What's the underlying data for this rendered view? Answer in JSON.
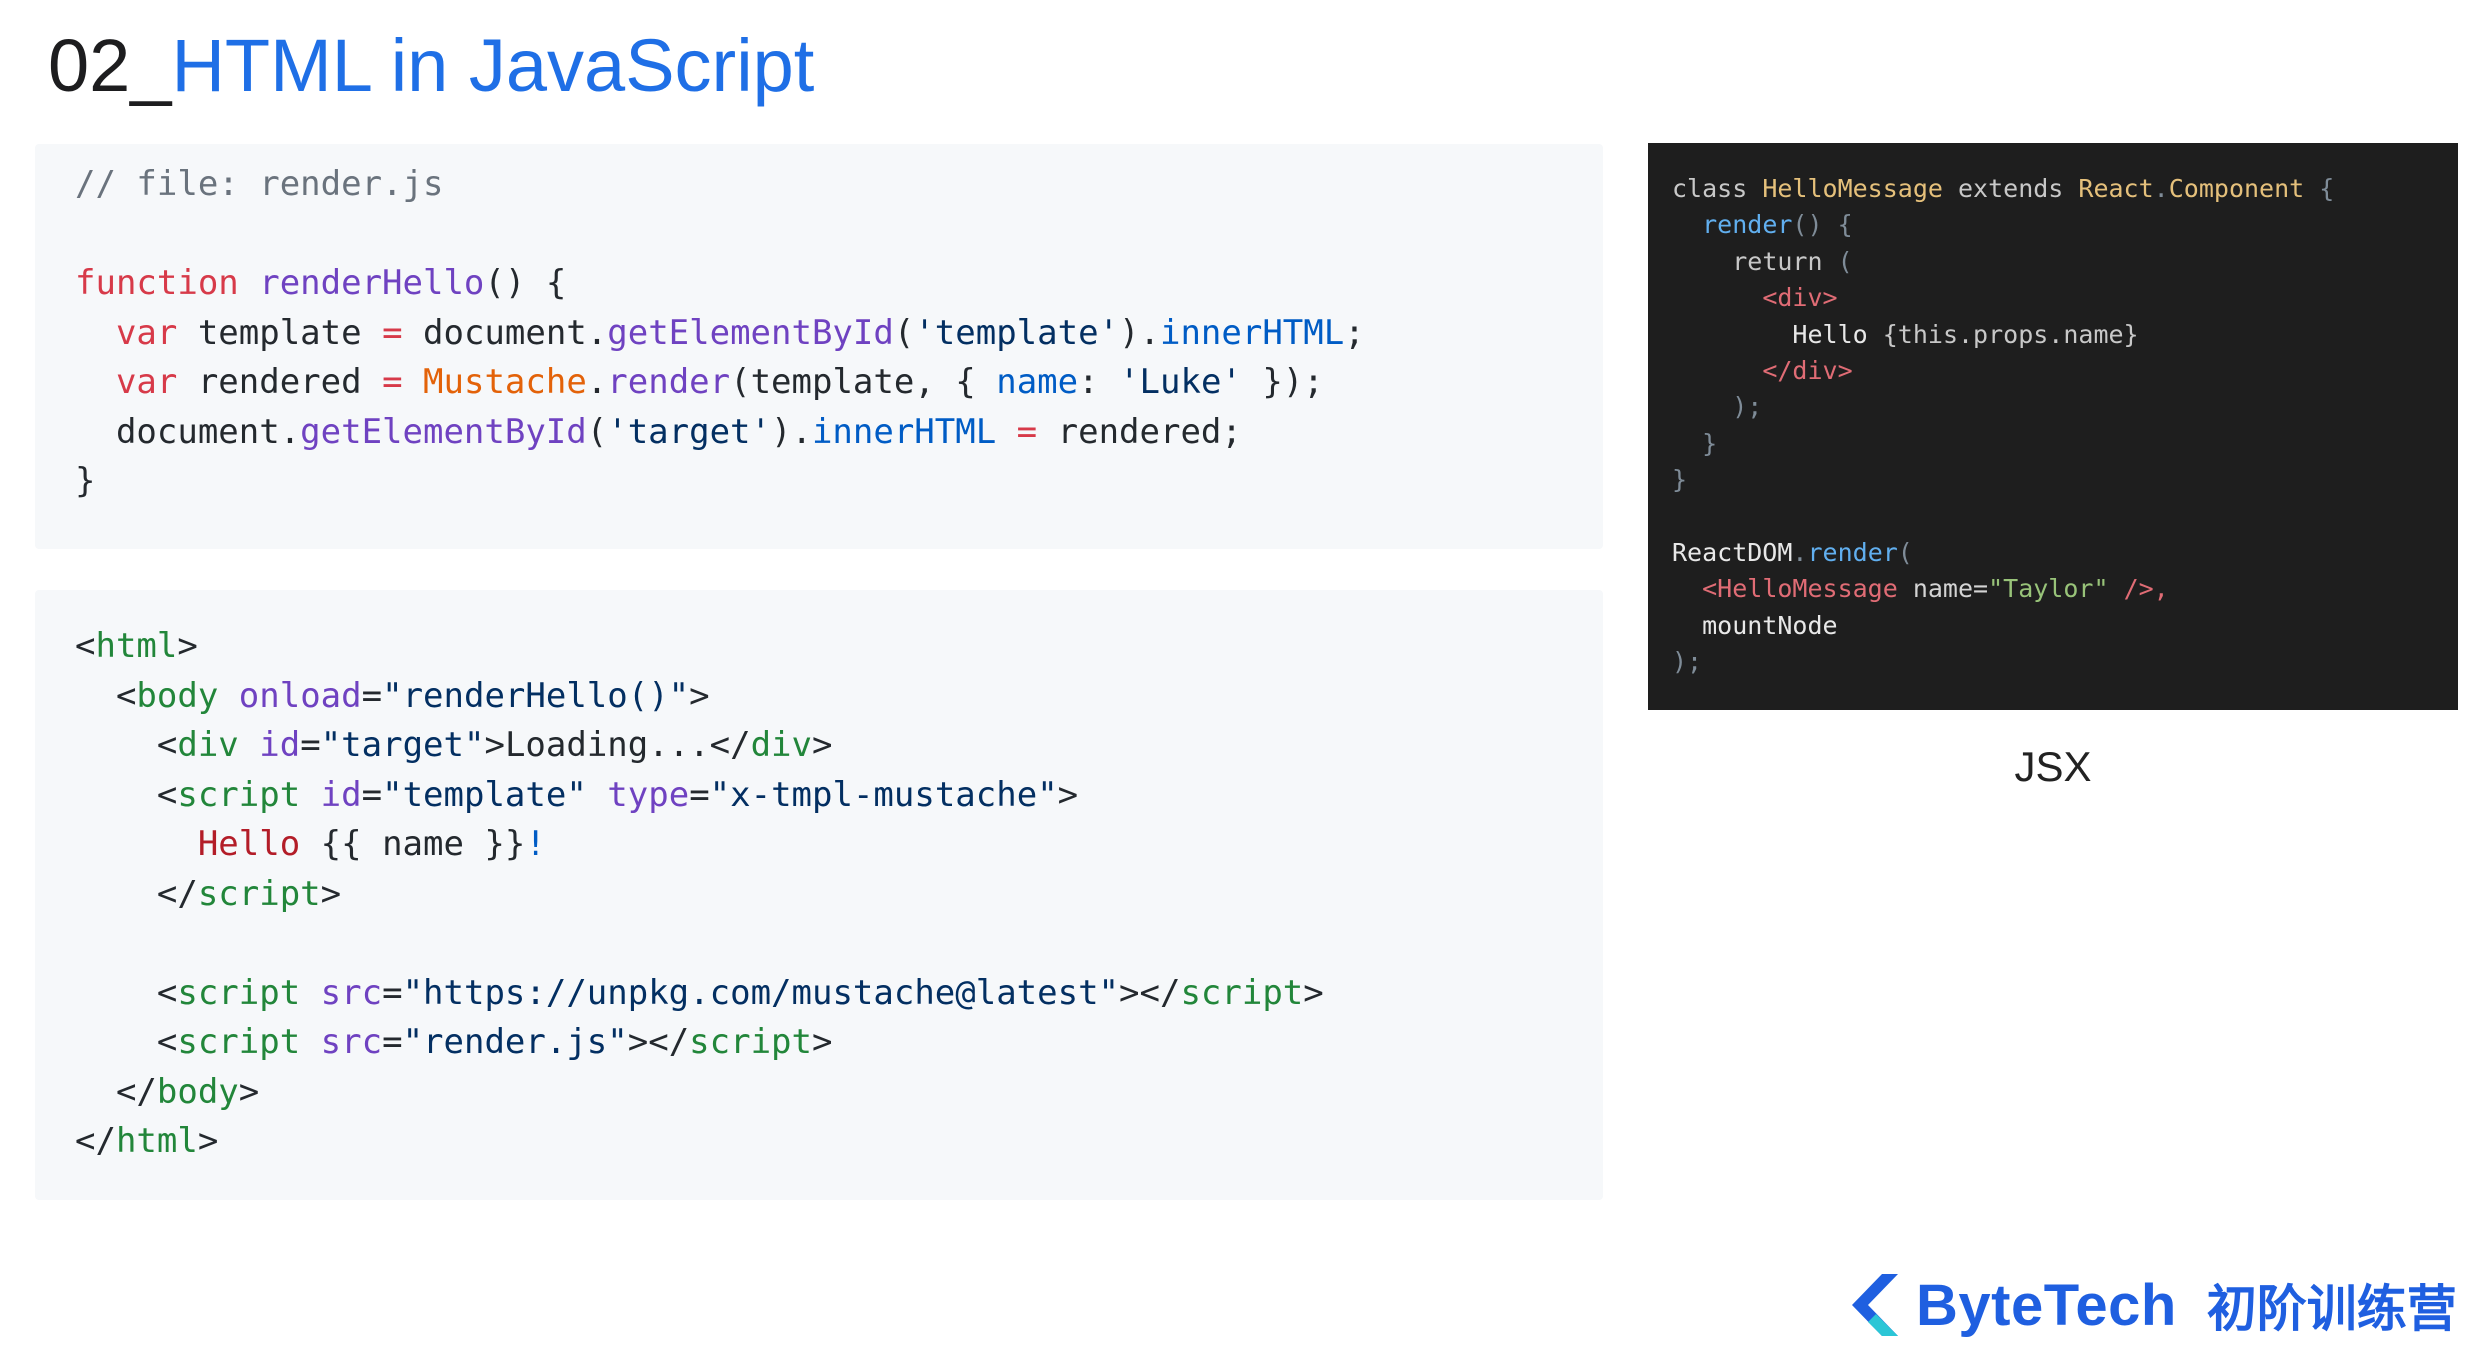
{
  "title": {
    "number": "02_",
    "text": "HTML in JavaScript"
  },
  "js_code": {
    "lines": [
      [
        {
          "t": "// file: render.js",
          "c": "cm"
        }
      ],
      [],
      [
        {
          "t": "function ",
          "c": "kw"
        },
        {
          "t": "renderHello",
          "c": "fn"
        },
        {
          "t": "() {",
          "c": ""
        }
      ],
      [
        {
          "t": "  var ",
          "c": "kw"
        },
        {
          "t": "template ",
          "c": ""
        },
        {
          "t": "=",
          "c": "kw"
        },
        {
          "t": " document.",
          "c": ""
        },
        {
          "t": "getElementById",
          "c": "fn"
        },
        {
          "t": "(",
          "c": ""
        },
        {
          "t": "'template'",
          "c": "st"
        },
        {
          "t": ").",
          "c": ""
        },
        {
          "t": "innerHTML",
          "c": "bl"
        },
        {
          "t": ";",
          "c": ""
        }
      ],
      [
        {
          "t": "  var ",
          "c": "kw"
        },
        {
          "t": "rendered ",
          "c": ""
        },
        {
          "t": "=",
          "c": "kw"
        },
        {
          "t": " ",
          "c": ""
        },
        {
          "t": "Mustache",
          "c": "cl"
        },
        {
          "t": ".",
          "c": ""
        },
        {
          "t": "render",
          "c": "fn"
        },
        {
          "t": "(template, { ",
          "c": ""
        },
        {
          "t": "name",
          "c": "bl"
        },
        {
          "t": ": ",
          "c": ""
        },
        {
          "t": "'Luke'",
          "c": "st"
        },
        {
          "t": " });",
          "c": ""
        }
      ],
      [
        {
          "t": "  document.",
          "c": ""
        },
        {
          "t": "getElementById",
          "c": "fn"
        },
        {
          "t": "(",
          "c": ""
        },
        {
          "t": "'target'",
          "c": "st"
        },
        {
          "t": ").",
          "c": ""
        },
        {
          "t": "innerHTML",
          "c": "bl"
        },
        {
          "t": " ",
          "c": ""
        },
        {
          "t": "=",
          "c": "kw"
        },
        {
          "t": " rendered;",
          "c": ""
        }
      ],
      [
        {
          "t": "}",
          "c": ""
        }
      ]
    ]
  },
  "html_code": {
    "lines": [
      [
        {
          "t": "<",
          "c": ""
        },
        {
          "t": "html",
          "c": "tg"
        },
        {
          "t": ">",
          "c": ""
        }
      ],
      [
        {
          "t": "  <",
          "c": ""
        },
        {
          "t": "body",
          "c": "tg"
        },
        {
          "t": " ",
          "c": ""
        },
        {
          "t": "onload",
          "c": "fn"
        },
        {
          "t": "=",
          "c": ""
        },
        {
          "t": "\"renderHello()\"",
          "c": "st"
        },
        {
          "t": ">",
          "c": ""
        }
      ],
      [
        {
          "t": "    <",
          "c": ""
        },
        {
          "t": "div",
          "c": "tg"
        },
        {
          "t": " ",
          "c": ""
        },
        {
          "t": "id",
          "c": "fn"
        },
        {
          "t": "=",
          "c": ""
        },
        {
          "t": "\"target\"",
          "c": "st"
        },
        {
          "t": ">Loading...</",
          "c": ""
        },
        {
          "t": "div",
          "c": "tg"
        },
        {
          "t": ">",
          "c": ""
        }
      ],
      [
        {
          "t": "    <",
          "c": ""
        },
        {
          "t": "script",
          "c": "tg"
        },
        {
          "t": " ",
          "c": ""
        },
        {
          "t": "id",
          "c": "fn"
        },
        {
          "t": "=",
          "c": ""
        },
        {
          "t": "\"template\"",
          "c": "st"
        },
        {
          "t": " ",
          "c": ""
        },
        {
          "t": "type",
          "c": "fn"
        },
        {
          "t": "=",
          "c": ""
        },
        {
          "t": "\"x-tmpl-mustache\"",
          "c": "st"
        },
        {
          "t": ">",
          "c": ""
        }
      ],
      [
        {
          "t": "      ",
          "c": ""
        },
        {
          "t": "Hello",
          "c": "brn"
        },
        {
          "t": " {{ name }}",
          "c": ""
        },
        {
          "t": "!",
          "c": "bl"
        }
      ],
      [
        {
          "t": "    </",
          "c": ""
        },
        {
          "t": "script",
          "c": "tg"
        },
        {
          "t": ">",
          "c": ""
        }
      ],
      [],
      [
        {
          "t": "    <",
          "c": ""
        },
        {
          "t": "script",
          "c": "tg"
        },
        {
          "t": " ",
          "c": ""
        },
        {
          "t": "src",
          "c": "fn"
        },
        {
          "t": "=",
          "c": ""
        },
        {
          "t": "\"https://unpkg.com/mustache@latest\"",
          "c": "st"
        },
        {
          "t": "></",
          "c": ""
        },
        {
          "t": "script",
          "c": "tg"
        },
        {
          "t": ">",
          "c": ""
        }
      ],
      [
        {
          "t": "    <",
          "c": ""
        },
        {
          "t": "script",
          "c": "tg"
        },
        {
          "t": " ",
          "c": ""
        },
        {
          "t": "src",
          "c": "fn"
        },
        {
          "t": "=",
          "c": ""
        },
        {
          "t": "\"render.js\"",
          "c": "st"
        },
        {
          "t": "></",
          "c": ""
        },
        {
          "t": "script",
          "c": "tg"
        },
        {
          "t": ">",
          "c": ""
        }
      ],
      [
        {
          "t": "  </",
          "c": ""
        },
        {
          "t": "body",
          "c": "tg"
        },
        {
          "t": ">",
          "c": ""
        }
      ],
      [
        {
          "t": "</",
          "c": ""
        },
        {
          "t": "html",
          "c": "tg"
        },
        {
          "t": ">",
          "c": ""
        }
      ]
    ]
  },
  "jsx_code": {
    "lines": [
      [
        {
          "t": "class ",
          "c": "dk-kw"
        },
        {
          "t": "HelloMessage",
          "c": "dk-cls"
        },
        {
          "t": " extends ",
          "c": "dk-kw"
        },
        {
          "t": "React",
          "c": "dk-cls"
        },
        {
          "t": ".",
          "c": "dk-pun"
        },
        {
          "t": "Component",
          "c": "dk-cls"
        },
        {
          "t": " {",
          "c": "dk-pun"
        }
      ],
      [
        {
          "t": "  ",
          "c": ""
        },
        {
          "t": "render",
          "c": "dk-fn"
        },
        {
          "t": "() {",
          "c": "dk-pun"
        }
      ],
      [
        {
          "t": "    ",
          "c": ""
        },
        {
          "t": "return",
          "c": "dk-kw"
        },
        {
          "t": " (",
          "c": "dk-pun"
        }
      ],
      [
        {
          "t": "      ",
          "c": ""
        },
        {
          "t": "<div>",
          "c": "dk-tag"
        }
      ],
      [
        {
          "t": "        ",
          "c": ""
        },
        {
          "t": "Hello ",
          "c": "dk-txt"
        },
        {
          "t": "{this.props.name}",
          "c": "dk-kw"
        }
      ],
      [
        {
          "t": "      ",
          "c": ""
        },
        {
          "t": "</div>",
          "c": "dk-tag"
        }
      ],
      [
        {
          "t": "    );",
          "c": "dk-pun"
        }
      ],
      [
        {
          "t": "  }",
          "c": "dk-pun"
        }
      ],
      [
        {
          "t": "}",
          "c": "dk-pun"
        }
      ],
      [],
      [
        {
          "t": "ReactDOM",
          "c": "dk-txt"
        },
        {
          "t": ".",
          "c": "dk-pun"
        },
        {
          "t": "render",
          "c": "dk-fn"
        },
        {
          "t": "(",
          "c": "dk-pun"
        }
      ],
      [
        {
          "t": "  ",
          "c": ""
        },
        {
          "t": "<HelloMessage",
          "c": "dk-tag"
        },
        {
          "t": " name=",
          "c": "dk-attr"
        },
        {
          "t": "\"Taylor\"",
          "c": "dk-str"
        },
        {
          "t": " />,",
          "c": "dk-tag"
        }
      ],
      [
        {
          "t": "  mountNode",
          "c": "dk-txt"
        }
      ],
      [
        {
          "t": ");",
          "c": "dk-pun"
        }
      ]
    ]
  },
  "caption": "JSX",
  "logo": {
    "brand": "ByteTech",
    "subtitle": "初阶训练营",
    "mark_color": "#1f5fe0",
    "mark_accent": "#2bc6d6"
  }
}
